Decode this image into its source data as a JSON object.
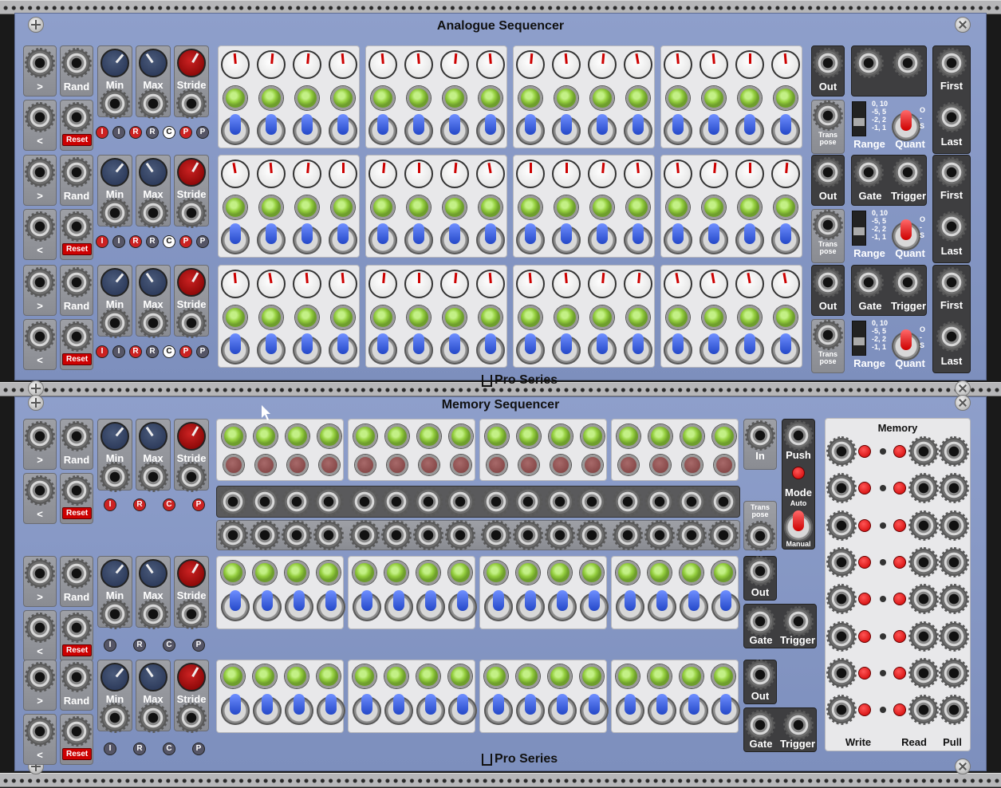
{
  "rails": [
    "top",
    "middle",
    "bottom"
  ],
  "analogue": {
    "title": "Analogue Sequencer",
    "brand": "Pro Series",
    "rows": [
      {
        "fwd": ">",
        "rand": "Rand",
        "back": "<",
        "reset": "Reset",
        "min": "Min",
        "max": "Max",
        "stride": "Stride",
        "tags": [
          "I",
          "I",
          "R",
          "R",
          "C",
          "P",
          "P"
        ],
        "out": "Out",
        "trans": "Trans pose",
        "range_text": "0, 10\n-5, 5\n-2, 2\n-1, 1",
        "range": "Range",
        "quant_text": "O\n-\nS",
        "quant": "Quant",
        "first": "First",
        "last": "Last",
        "gate": "",
        "trigger": ""
      },
      {
        "fwd": ">",
        "rand": "Rand",
        "back": "<",
        "reset": "Reset",
        "min": "Min",
        "max": "Max",
        "stride": "Stride",
        "tags": [
          "I",
          "I",
          "R",
          "R",
          "C",
          "P",
          "P"
        ],
        "out": "Out",
        "trans": "Trans pose",
        "range_text": "0, 10\n-5, 5\n-2, 2\n-1, 1",
        "range": "Range",
        "quant_text": "O\n-\nS",
        "quant": "Quant",
        "first": "First",
        "last": "Last",
        "gate": "Gate",
        "trigger": "Trigger"
      },
      {
        "fwd": ">",
        "rand": "Rand",
        "back": "<",
        "reset": "Reset",
        "min": "Min",
        "max": "Max",
        "stride": "Stride",
        "tags": [
          "I",
          "I",
          "R",
          "R",
          "C",
          "P",
          "P"
        ],
        "out": "Out",
        "trans": "Trans pose",
        "range_text": "0, 10\n-5, 5\n-2, 2\n-1, 1",
        "range": "Range",
        "quant_text": "O\n-\nS",
        "quant": "Quant",
        "first": "First",
        "last": "Last",
        "gate": "Gate",
        "trigger": "Trigger"
      }
    ]
  },
  "memory": {
    "title": "Memory Sequencer",
    "brand": "Pro Series",
    "rows": [
      {
        "fwd": ">",
        "rand": "Rand",
        "back": "<",
        "reset": "Reset",
        "min": "Min",
        "max": "Max",
        "stride": "Stride",
        "tags": [
          "I",
          "R",
          "C",
          "P"
        ],
        "in": "In",
        "trans": "Trans pose"
      },
      {
        "fwd": ">",
        "rand": "Rand",
        "back": "<",
        "reset": "Reset",
        "min": "Min",
        "max": "Max",
        "stride": "Stride",
        "tags": [
          "I",
          "R",
          "C",
          "P"
        ],
        "out": "Out",
        "gate": "Gate",
        "trigger": "Trigger"
      },
      {
        "fwd": ">",
        "rand": "Rand",
        "back": "<",
        "reset": "Reset",
        "min": "Min",
        "max": "Max",
        "stride": "Stride",
        "tags": [
          "I",
          "R",
          "C",
          "P"
        ],
        "out": "Out",
        "gate": "Gate",
        "trigger": "Trigger"
      }
    ],
    "push": "Push",
    "mode": "Mode",
    "auto": "Auto",
    "manual": "Manual",
    "mem_title": "Memory",
    "write": "Write",
    "read": "Read",
    "pull": "Pull"
  }
}
